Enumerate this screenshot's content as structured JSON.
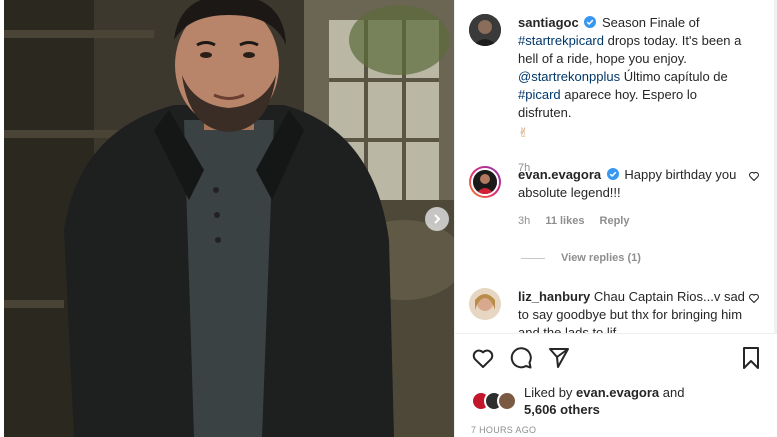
{
  "post": {
    "author": "santiagoc",
    "caption_line1": "Season Finale of",
    "hashtag_show": "#startrekpicard",
    "caption_line2": " drops today. It's been a hell of a ride, hope you enjoy. ",
    "mention": "@startrekonpplus",
    "caption_line3": " Último capítulo de ",
    "hashtag_short": "#picard",
    "caption_line4": " aparece hoy. Espero lo disfruten.",
    "emoji": "✌",
    "time": "7h"
  },
  "comments": [
    {
      "user": "evan.evagora",
      "text": "Happy birthday you absolute legend!!!",
      "time": "3h",
      "likes": "11 likes",
      "reply": "Reply"
    },
    {
      "user": "liz_hanbury",
      "text": "Chau Captain Rios...v sad to say goodbye but thx for bringing him and the lads to lif..."
    }
  ],
  "view_replies": "View replies (1)",
  "liked_by": {
    "prefix": "Liked by ",
    "user": "evan.evagora",
    "and": " and",
    "others": "5,606 others"
  },
  "timestamp": "7 HOURS AGO",
  "colors": {
    "verified": "#3897f0",
    "link": "#00376b",
    "muted": "#8e8e8e",
    "text": "#262626"
  },
  "icons": [
    "verified-badge-icon",
    "heart-icon",
    "comment-icon",
    "share-icon",
    "bookmark-icon",
    "chevron-right-icon"
  ]
}
